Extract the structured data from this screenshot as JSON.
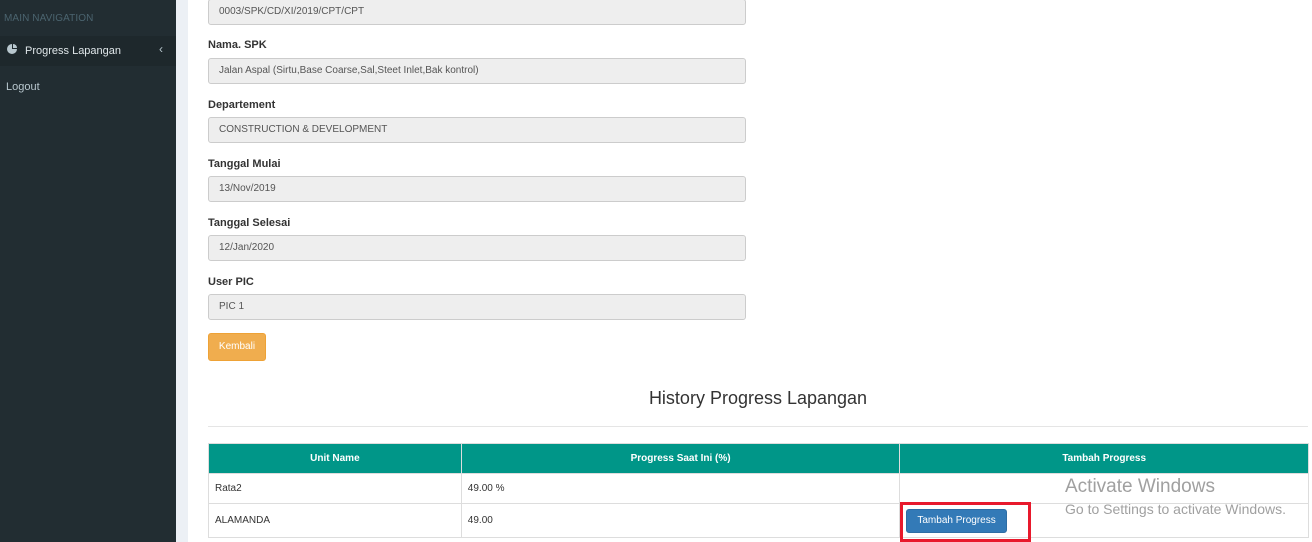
{
  "sidebar": {
    "header": "MAIN NAVIGATION",
    "items": [
      {
        "label": "Progress Lapangan",
        "icon": "pie-chart-icon"
      },
      {
        "label": "Logout"
      }
    ]
  },
  "form": {
    "spk_no": {
      "value": "0003/SPK/CD/XI/2019/CPT/CPT"
    },
    "nama_spk": {
      "label": "Nama. SPK",
      "value": "Jalan Aspal (Sirtu,Base Coarse,Sal,Steet Inlet,Bak kontrol)"
    },
    "departement": {
      "label": "Departement",
      "value": "CONSTRUCTION & DEVELOPMENT"
    },
    "tanggal_mulai": {
      "label": "Tanggal Mulai",
      "value": "13/Nov/2019"
    },
    "tanggal_selesai": {
      "label": "Tanggal Selesai",
      "value": "12/Jan/2020"
    },
    "user_pic": {
      "label": "User PIC",
      "value": "PIC 1"
    },
    "back_label": "Kembali"
  },
  "history": {
    "title": "History Progress Lapangan",
    "columns": [
      "Unit Name",
      "Progress Saat Ini (%)",
      "Tambah Progress"
    ],
    "rows": [
      {
        "unit": "Rata2",
        "progress": "49.00 %"
      },
      {
        "unit": "ALAMANDA",
        "progress": "49.00",
        "action": "Tambah Progress"
      }
    ]
  },
  "watermark": {
    "line1": "Activate Windows",
    "line2": "Go to Settings to activate Windows."
  },
  "colors": {
    "sidebar_bg": "#222d32",
    "table_header": "#009688",
    "warning_button": "#f0ad4e",
    "primary_button": "#337ab7",
    "highlight_box": "#e8192c"
  }
}
